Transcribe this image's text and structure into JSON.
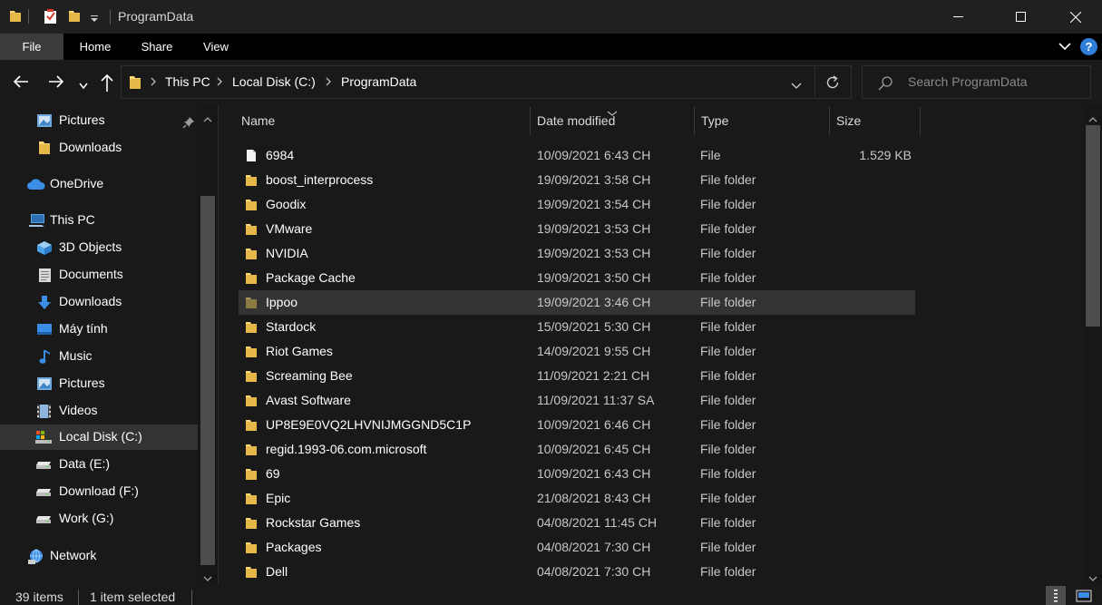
{
  "window": {
    "title": "ProgramData",
    "controls": {
      "minimize": "minimize",
      "maximize": "maximize",
      "close": "close"
    }
  },
  "ribbon": {
    "tabs": [
      {
        "label": "File",
        "active": true
      },
      {
        "label": "Home"
      },
      {
        "label": "Share"
      },
      {
        "label": "View"
      }
    ],
    "help_label": "?"
  },
  "address": {
    "breadcrumbs": [
      "This PC",
      "Local Disk (C:)",
      "ProgramData"
    ]
  },
  "search": {
    "placeholder": "Search ProgramData"
  },
  "sidebar": {
    "items": [
      {
        "label": "Pictures",
        "icon": "pictures-icon",
        "pinned": true
      },
      {
        "label": "Downloads",
        "icon": "folder-icon"
      },
      {
        "label": "OneDrive",
        "icon": "onedrive-icon"
      },
      {
        "label": "This PC",
        "icon": "this-pc-icon"
      },
      {
        "label": "3D Objects",
        "icon": "3d-objects-icon"
      },
      {
        "label": "Documents",
        "icon": "documents-icon"
      },
      {
        "label": "Downloads",
        "icon": "downloads-icon"
      },
      {
        "label": "Máy tính",
        "icon": "desktop-icon"
      },
      {
        "label": "Music",
        "icon": "music-icon"
      },
      {
        "label": "Pictures",
        "icon": "pictures-icon"
      },
      {
        "label": "Videos",
        "icon": "videos-icon"
      },
      {
        "label": "Local Disk (C:)",
        "icon": "local-disk-icon",
        "selected": true
      },
      {
        "label": "Data (E:)",
        "icon": "drive-icon"
      },
      {
        "label": "Download (F:)",
        "icon": "drive-icon"
      },
      {
        "label": "Work (G:)",
        "icon": "drive-icon"
      },
      {
        "label": "Network",
        "icon": "network-icon"
      }
    ]
  },
  "filelist": {
    "columns": {
      "name": "Name",
      "date": "Date modified",
      "type": "Type",
      "size": "Size"
    },
    "rows": [
      {
        "name": "6984",
        "date": "10/09/2021 6:43 CH",
        "type": "File",
        "size": "1.529 KB",
        "icon": "file-icon"
      },
      {
        "name": "boost_interprocess",
        "date": "19/09/2021 3:58 CH",
        "type": "File folder",
        "size": "",
        "icon": "folder-icon"
      },
      {
        "name": "Goodix",
        "date": "19/09/2021 3:54 CH",
        "type": "File folder",
        "size": "",
        "icon": "folder-icon"
      },
      {
        "name": "VMware",
        "date": "19/09/2021 3:53 CH",
        "type": "File folder",
        "size": "",
        "icon": "folder-icon"
      },
      {
        "name": "NVIDIA",
        "date": "19/09/2021 3:53 CH",
        "type": "File folder",
        "size": "",
        "icon": "folder-icon"
      },
      {
        "name": "Package Cache",
        "date": "19/09/2021 3:50 CH",
        "type": "File folder",
        "size": "",
        "icon": "folder-icon"
      },
      {
        "name": "Ippoo",
        "date": "19/09/2021 3:46 CH",
        "type": "File folder",
        "size": "",
        "icon": "folder-icon",
        "highlighted": true
      },
      {
        "name": "Stardock",
        "date": "15/09/2021 5:30 CH",
        "type": "File folder",
        "size": "",
        "icon": "folder-icon"
      },
      {
        "name": "Riot Games",
        "date": "14/09/2021 9:55 CH",
        "type": "File folder",
        "size": "",
        "icon": "folder-icon"
      },
      {
        "name": "Screaming Bee",
        "date": "11/09/2021 2:21 CH",
        "type": "File folder",
        "size": "",
        "icon": "folder-icon"
      },
      {
        "name": "Avast Software",
        "date": "11/09/2021 11:37 SA",
        "type": "File folder",
        "size": "",
        "icon": "folder-icon"
      },
      {
        "name": "UP8E9E0VQ2LHVNIJMGGND5C1P",
        "date": "10/09/2021 6:46 CH",
        "type": "File folder",
        "size": "",
        "icon": "folder-icon"
      },
      {
        "name": "regid.1993-06.com.microsoft",
        "date": "10/09/2021 6:45 CH",
        "type": "File folder",
        "size": "",
        "icon": "folder-icon"
      },
      {
        "name": "69",
        "date": "10/09/2021 6:43 CH",
        "type": "File folder",
        "size": "",
        "icon": "folder-icon"
      },
      {
        "name": "Epic",
        "date": "21/08/2021 8:43 CH",
        "type": "File folder",
        "size": "",
        "icon": "folder-icon"
      },
      {
        "name": "Rockstar Games",
        "date": "04/08/2021 11:45 CH",
        "type": "File folder",
        "size": "",
        "icon": "folder-icon"
      },
      {
        "name": "Packages",
        "date": "04/08/2021 7:30 CH",
        "type": "File folder",
        "size": "",
        "icon": "folder-icon"
      },
      {
        "name": "Dell",
        "date": "04/08/2021 7:30 CH",
        "type": "File folder",
        "size": "",
        "icon": "folder-icon"
      }
    ]
  },
  "status": {
    "item_count": "39 items",
    "selection": "1 item selected"
  },
  "colors": {
    "background": "#191919",
    "titlebar": "#202020",
    "ribbon": "#000000",
    "folder": "#f8d775",
    "selection": "#333333",
    "accent": "#2f7fd8"
  }
}
